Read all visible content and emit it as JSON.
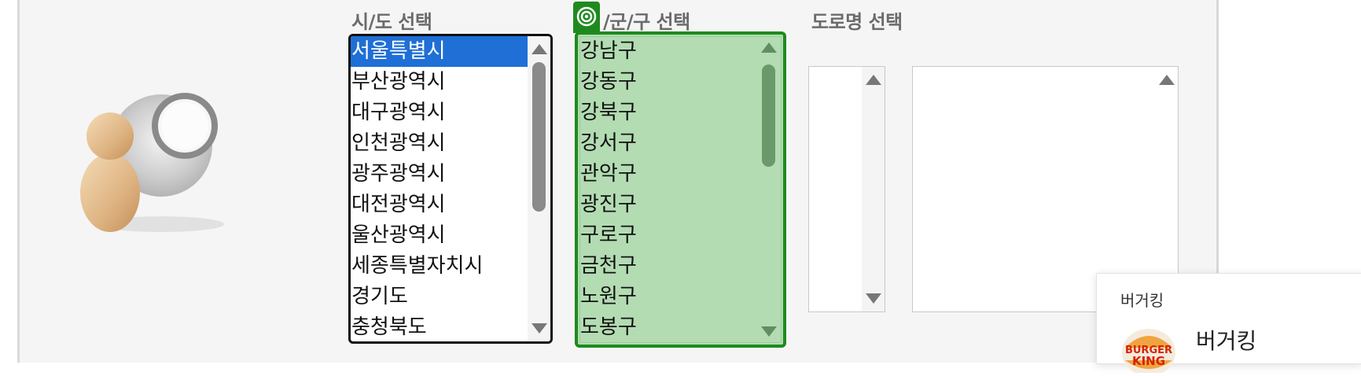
{
  "headings": {
    "sido": "시/도 선택",
    "gungu": "/군/구 선택",
    "road": "도로명 선택"
  },
  "sido_list": [
    "서울특별시",
    "부산광역시",
    "대구광역시",
    "인천광역시",
    "광주광역시",
    "대전광역시",
    "울산광역시",
    "세종특별자치시",
    "경기도",
    "충청북도"
  ],
  "sido_selected": "서울특별시",
  "gungu_list": [
    "강남구",
    "강동구",
    "강북구",
    "강서구",
    "관악구",
    "광진구",
    "구로구",
    "금천구",
    "노원구",
    "도봉구"
  ],
  "popup": {
    "title": "버거킹",
    "name": "버거킹",
    "subtitle": "",
    "logo_text_top": "BURGER",
    "logo_text_bottom": "KING"
  },
  "colors": {
    "selection": "#1f6fd6",
    "focus_green": "#1e8a1e",
    "list_green_bg": "#b3dcb3"
  },
  "icons": {
    "target": "target-icon",
    "avatar": "user-search-icon"
  }
}
